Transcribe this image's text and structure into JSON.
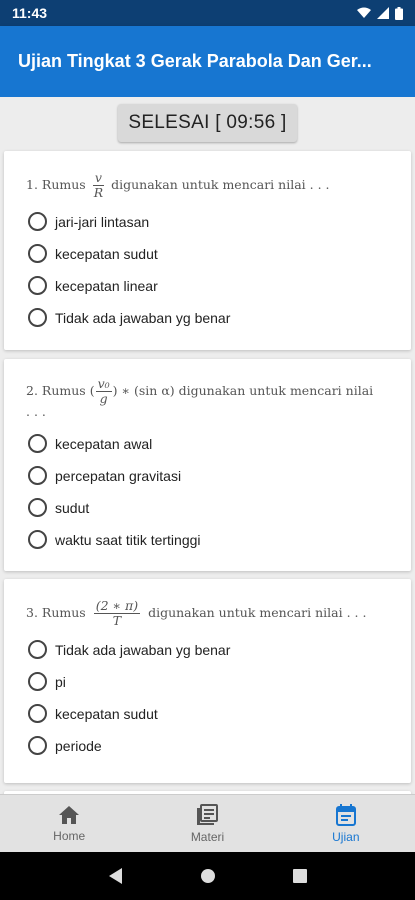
{
  "status_bar": {
    "time": "11:43"
  },
  "app_bar": {
    "title": "Ujian Tingkat 3 Gerak Parabola Dan Ger..."
  },
  "finish_button": {
    "label": "SELESAI",
    "timer": "09:56"
  },
  "questions": [
    {
      "number": "1.",
      "word": "Rumus",
      "formula": {
        "num": "v",
        "den": "R"
      },
      "suffix": "digunakan untuk mencari nilai . . .",
      "options": [
        "jari-jari lintasan",
        "kecepatan sudut",
        "kecepatan linear",
        "Tidak ada jawaban yg benar"
      ]
    },
    {
      "number": "2.",
      "word": "Rumus",
      "formula": {
        "num": "v₀",
        "den": "g"
      },
      "formula_extra": "∗ (sin α)",
      "suffix": "digunakan untuk mencari nilai",
      "suffix_line2": ". . .",
      "options": [
        "kecepatan awal",
        "percepatan gravitasi",
        "sudut",
        "waktu saat titik tertinggi"
      ]
    },
    {
      "number": "3.",
      "word": "Rumus",
      "formula": {
        "num": "(2 ∗ π)",
        "den": "T"
      },
      "suffix": "digunakan untuk mencari nilai . . .",
      "options": [
        "Tidak ada jawaban yg benar",
        "pi",
        "kecepatan sudut",
        "periode"
      ]
    }
  ],
  "bottom_nav": [
    {
      "label": "Home",
      "icon": "home-icon",
      "active": false
    },
    {
      "label": "Materi",
      "icon": "materi-icon",
      "active": false
    },
    {
      "label": "Ujian",
      "icon": "ujian-icon",
      "active": true
    }
  ],
  "colors": {
    "accent": "#1776d1",
    "status_bar": "#0d3f73"
  }
}
